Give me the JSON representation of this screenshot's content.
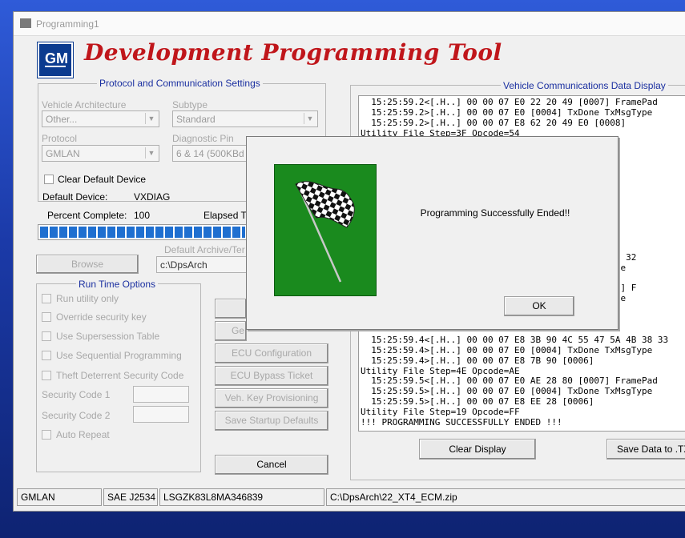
{
  "window": {
    "title": "Programming1"
  },
  "header": {
    "logo_text": "GM",
    "app_title": "Development Programming Tool"
  },
  "protocol_group": {
    "title": "Protocol and Communication Settings",
    "vehicle_architecture_label": "Vehicle Architecture",
    "vehicle_architecture_value": "Other...",
    "subtype_label": "Subtype",
    "subtype_value": "Standard",
    "protocol_label": "Protocol",
    "protocol_value": "GMLAN",
    "diagnostic_pin_label": "Diagnostic Pin",
    "diagnostic_pin_value": "6 & 14 (500KBd",
    "clear_default_device_label": "Clear Default Device",
    "default_device_label": "Default Device:",
    "default_device_value": "VXDIAG"
  },
  "progress": {
    "percent_label": "Percent Complete:",
    "percent_value": "100",
    "percent": 100,
    "elapsed_label": "Elapsed T"
  },
  "archive": {
    "browse_label": "Browse",
    "default_archive_label": "Default Archive/Ter",
    "path_value": "c:\\DpsArch"
  },
  "runtime_group": {
    "title": "Run Time Options",
    "options": [
      "Run utility only",
      "Override security key",
      "Use Supersession Table",
      "Use Sequential Programming",
      "Theft Deterrent Security Code"
    ],
    "security_code_1_label": "Security Code 1",
    "security_code_2_label": "Security Code 2",
    "auto_repeat_label": "Auto Repeat"
  },
  "buttons": {
    "partial_top": "",
    "partial_ge": "Ge",
    "ecu_configuration": "ECU Configuration",
    "ecu_bypass_ticket": "ECU Bypass Ticket",
    "veh_key_provisioning": "Veh. Key Provisioning",
    "save_startup_defaults": "Save Startup Defaults",
    "cancel": "Cancel",
    "clear_display": "Clear Display",
    "save_data": "Save Data to .TX"
  },
  "log": {
    "title": "Vehicle Communications Data Display",
    "lines": [
      "  15:25:59.2<[.H..] 00 00 07 E0 22 20 49 [0007] FramePad",
      "  15:25:59.2>[.H..] 00 00 07 E0 [0004] TxDone TxMsgType",
      "  15:25:59.2>[.H..] 00 00 07 E8 62 20 49 E0 [0008]",
      "Utility File Step=3F Opcode=54",
      "",
      "",
      "",
      "",
      "",
      "",
      "",
      "",
      "",
      "",
      "",
      "                                         30 30 35 32",
      "                                         TxMsgType",
      "",
      "                                         30 [0010] F",
      "                                         TxMsgType",
      "",
      "",
      "",
      "  15:25:59.4<[.H..] 00 00 07 E8 3B 90 4C 55 47 5A 4B 38 33",
      "  15:25:59.4>[.H..] 00 00 07 E0 [0004] TxDone TxMsgType",
      "  15:25:59.4>[.H..] 00 00 07 E8 7B 90 [0006]",
      "Utility File Step=4E Opcode=AE",
      "  15:25:59.5<[.H..] 00 00 07 E0 AE 28 80 [0007] FramePad",
      "  15:25:59.5>[.H..] 00 00 07 E0 [0004] TxDone TxMsgType",
      "  15:25:59.5>[.H..] 00 00 07 E8 EE 28 [0006]",
      "Utility File Step=19 Opcode=FF",
      "!!! PROGRAMMING SUCCESSFULLY ENDED !!!"
    ]
  },
  "modal": {
    "message": "Programming Successfully Ended!!",
    "ok_label": "OK",
    "image_icon": "checkered-flag-icon",
    "image_bg": "#1a8a1e"
  },
  "status_bar": {
    "protocol": "GMLAN",
    "standard": "SAE J2534",
    "vin": "LSGZK83L8MA346839",
    "file": "C:\\DpsArch\\22_XT4_ECM.zip"
  },
  "colors": {
    "title_red": "#c0161b",
    "group_title_blue": "#1a2fa0",
    "progress_blue": "#1f6fd0",
    "gm_blue": "#0b3b8f"
  }
}
